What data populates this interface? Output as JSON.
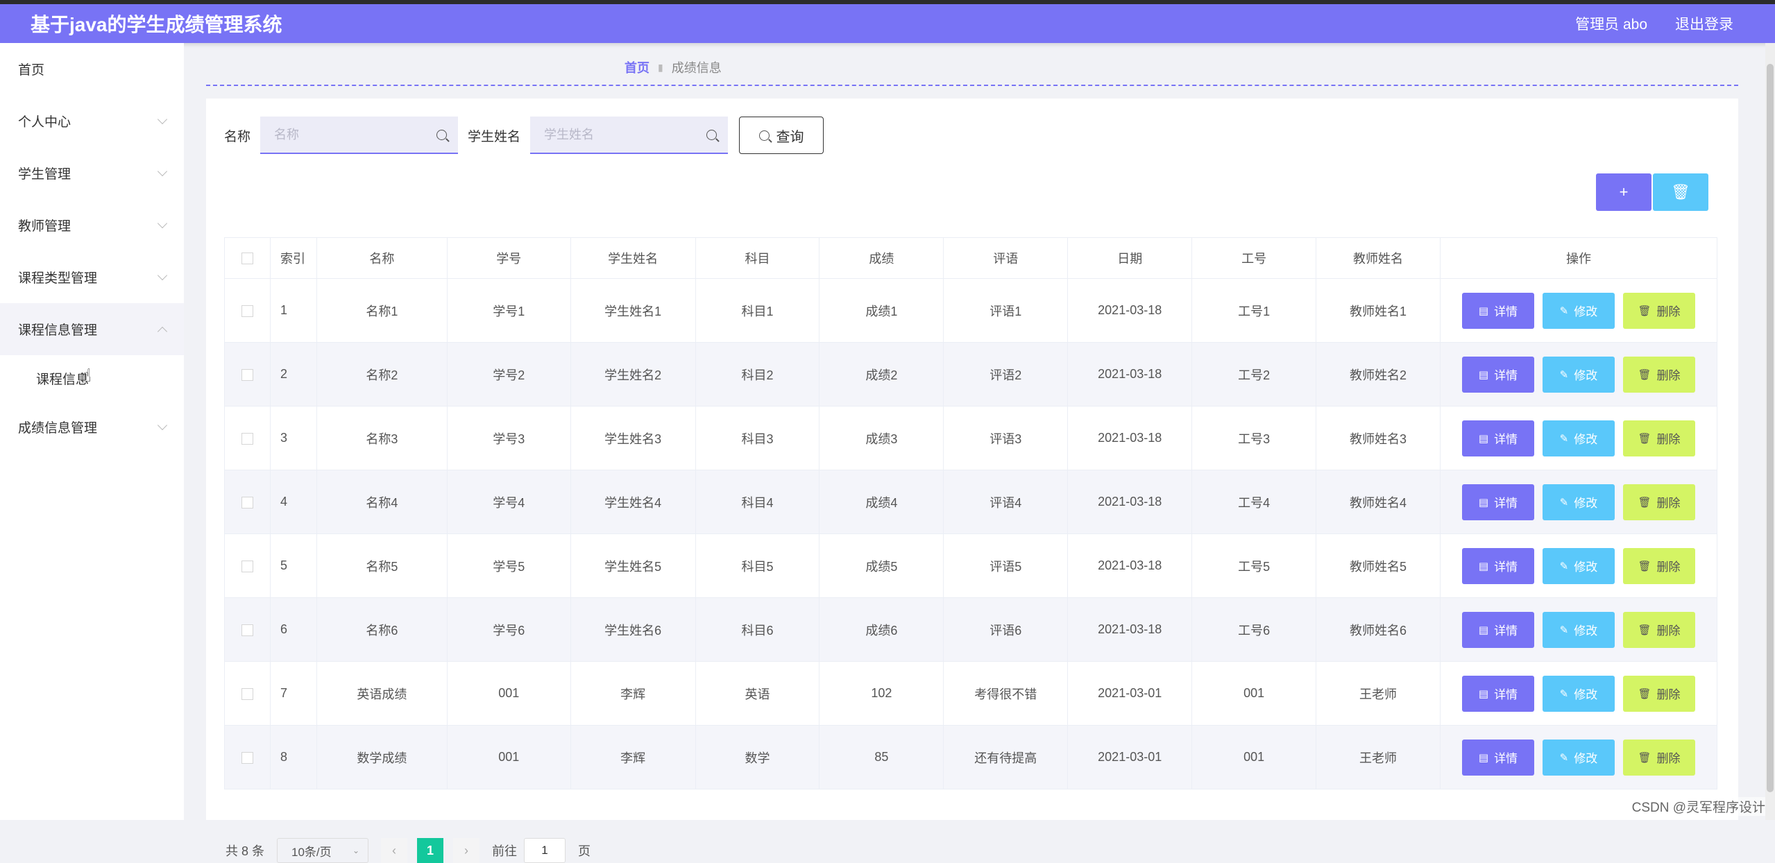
{
  "header": {
    "title": "基于java的学生成绩管理系统",
    "user": "管理员 abo",
    "logout": "退出登录"
  },
  "sidebar": {
    "items": [
      {
        "label": "首页"
      },
      {
        "label": "个人中心"
      },
      {
        "label": "学生管理"
      },
      {
        "label": "教师管理"
      },
      {
        "label": "课程类型管理"
      },
      {
        "label": "课程信息管理"
      },
      {
        "label": "成绩信息管理"
      }
    ],
    "sub_item": "课程信息"
  },
  "breadcrumb": {
    "home": "首页",
    "current": "成绩信息"
  },
  "search": {
    "name_label": "名称",
    "name_placeholder": "名称",
    "student_label": "学生姓名",
    "student_placeholder": "学生姓名",
    "query_button": "查询"
  },
  "toolbar": {
    "add": "+",
    "delete": "🗑"
  },
  "table": {
    "headers": [
      "索引",
      "名称",
      "学号",
      "学生姓名",
      "科目",
      "成绩",
      "评语",
      "日期",
      "工号",
      "教师姓名",
      "操作"
    ],
    "rows": [
      [
        "1",
        "名称1",
        "学号1",
        "学生姓名1",
        "科目1",
        "成绩1",
        "评语1",
        "2021-03-18",
        "工号1",
        "教师姓名1"
      ],
      [
        "2",
        "名称2",
        "学号2",
        "学生姓名2",
        "科目2",
        "成绩2",
        "评语2",
        "2021-03-18",
        "工号2",
        "教师姓名2"
      ],
      [
        "3",
        "名称3",
        "学号3",
        "学生姓名3",
        "科目3",
        "成绩3",
        "评语3",
        "2021-03-18",
        "工号3",
        "教师姓名3"
      ],
      [
        "4",
        "名称4",
        "学号4",
        "学生姓名4",
        "科目4",
        "成绩4",
        "评语4",
        "2021-03-18",
        "工号4",
        "教师姓名4"
      ],
      [
        "5",
        "名称5",
        "学号5",
        "学生姓名5",
        "科目5",
        "成绩5",
        "评语5",
        "2021-03-18",
        "工号5",
        "教师姓名5"
      ],
      [
        "6",
        "名称6",
        "学号6",
        "学生姓名6",
        "科目6",
        "成绩6",
        "评语6",
        "2021-03-18",
        "工号6",
        "教师姓名6"
      ],
      [
        "7",
        "英语成绩",
        "001",
        "李辉",
        "英语",
        "102",
        "考得很不错",
        "2021-03-01",
        "001",
        "王老师"
      ],
      [
        "8",
        "数学成绩",
        "001",
        "李辉",
        "数学",
        "85",
        "还有待提高",
        "2021-03-01",
        "001",
        "王老师"
      ]
    ],
    "actions": {
      "detail": "详情",
      "edit": "修改",
      "remove": "删除"
    }
  },
  "pagination": {
    "total": "共 8 条",
    "page_size": "10条/页",
    "current_page": "1",
    "goto_label": "前往",
    "goto_value": "1",
    "page_suffix": "页"
  },
  "watermark": "CSDN @灵军程序设计",
  "colors": {
    "primary": "#7873f5",
    "info": "#5ac8fa",
    "warn": "#d4f464",
    "pager": "#13c89c"
  }
}
